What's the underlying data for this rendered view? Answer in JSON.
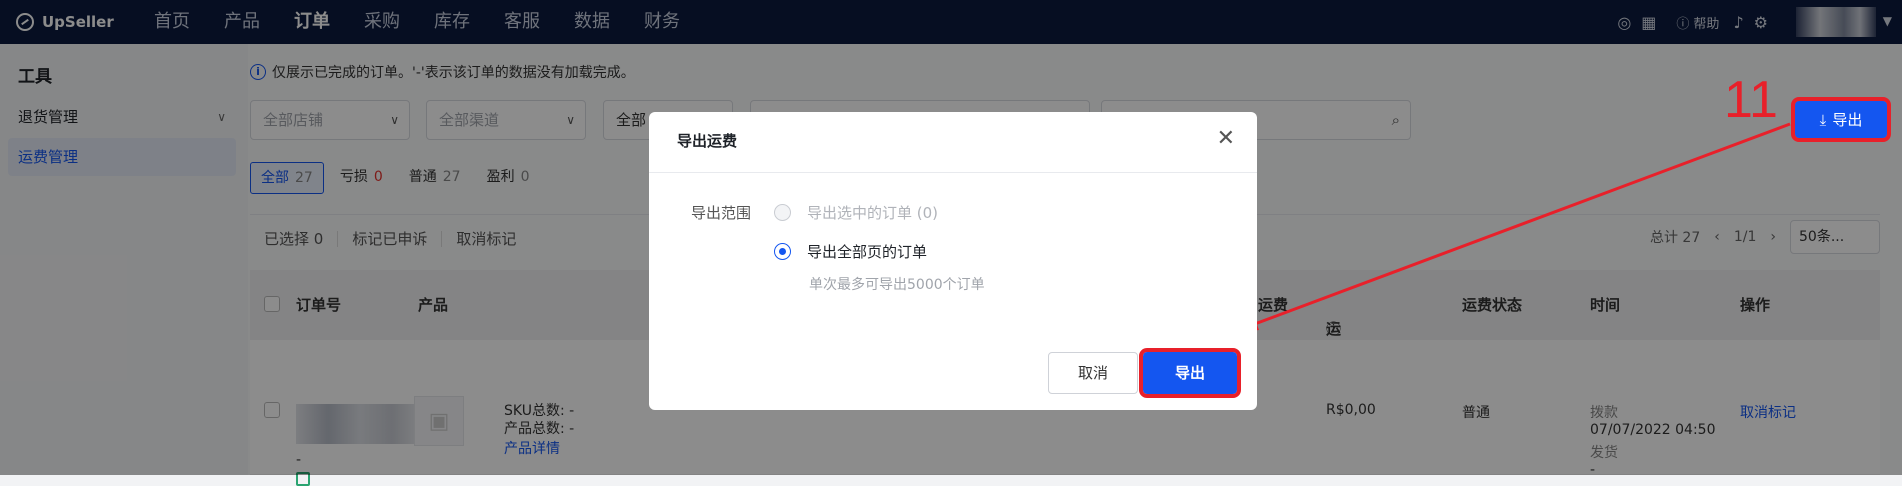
{
  "nav": {
    "brand": "UpSeller",
    "items": [
      "首页",
      "产品",
      "订单",
      "采购",
      "库存",
      "客服",
      "数据",
      "财务"
    ],
    "active": "订单",
    "help": "帮助"
  },
  "sidebar": {
    "title": "工具",
    "items": [
      {
        "label": "退货管理"
      },
      {
        "label": "运费管理"
      }
    ]
  },
  "notice": "仅展示已完成的订单。'-'表示该订单的数据没有加载完成。",
  "filters": {
    "store": "全部店铺",
    "channel": "全部渠道",
    "status": "全部"
  },
  "tabs": [
    {
      "label": "全部",
      "count": "27"
    },
    {
      "label": "亏损",
      "count": "0"
    },
    {
      "label": "普通",
      "count": "27"
    },
    {
      "label": "盈利",
      "count": "0"
    }
  ],
  "toolbar": {
    "selected": "已选择 0",
    "mark": "标记已申诉",
    "unmark": "取消标记"
  },
  "pager": {
    "total": "总计 27",
    "page": "1/1",
    "size": "50条..."
  },
  "table": {
    "headers": {
      "order": "订单号",
      "product": "产品",
      "fee": "运费",
      "diff": "运费差额",
      "status": "运费状态",
      "time": "时间",
      "action": "操作"
    },
    "row": {
      "dash": "-",
      "sku": "SKU总数: -",
      "count": "产品总数: -",
      "detail": "产品详情",
      "diff": "R$0,00",
      "status": "普通",
      "time_label": "拨款",
      "time": "07/07/2022 04:50",
      "ship_label": "发货",
      "ship": "-",
      "action": "取消标记"
    }
  },
  "top_export": "导出",
  "annotation": "11",
  "modal": {
    "title": "导出运费",
    "range_label": "导出范围",
    "opt1": "导出选中的订单 (0)",
    "opt2": "导出全部页的订单",
    "hint": "单次最多可导出5000个订单",
    "cancel": "取消",
    "export": "导出"
  },
  "colors": {
    "primary": "#1456f0",
    "highlight": "#e8202a",
    "nav_bg": "#0b1a3e"
  }
}
